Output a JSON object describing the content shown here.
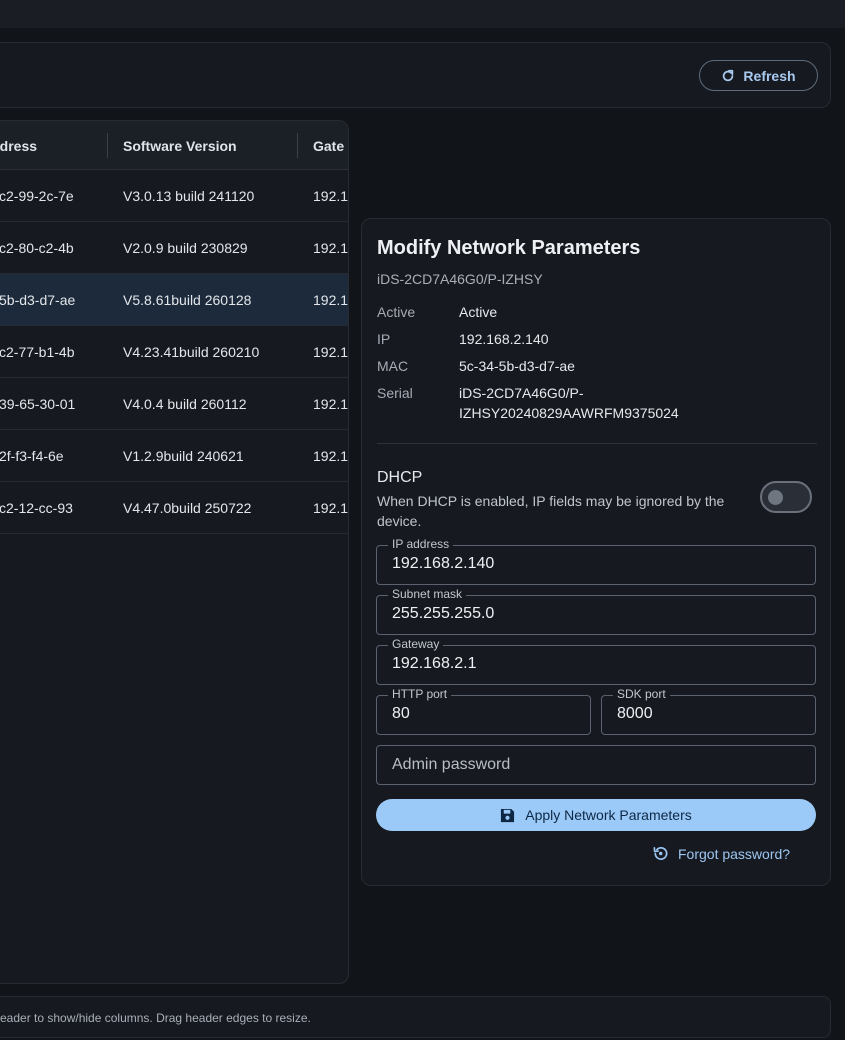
{
  "toolbar": {
    "refresh_label": "Refresh"
  },
  "table": {
    "columns": [
      "Address",
      "Software Version",
      "Gate"
    ],
    "rows": [
      {
        "address": "c2-99-2c-7e",
        "version": "V3.0.13 build 241120",
        "gateway": "192.1"
      },
      {
        "address": "c2-80-c2-4b",
        "version": "V2.0.9 build 230829",
        "gateway": "192.1"
      },
      {
        "address": "5b-d3-d7-ae",
        "version": "V5.8.61build 260128",
        "gateway": "192.1"
      },
      {
        "address": "c2-77-b1-4b",
        "version": "V4.23.41build 260210",
        "gateway": "192.1"
      },
      {
        "address": "39-65-30-01",
        "version": "V4.0.4 build 260112",
        "gateway": "192.1"
      },
      {
        "address": "2f-f3-f4-6e",
        "version": "V1.2.9build 240621",
        "gateway": "192.1"
      },
      {
        "address": "c2-12-cc-93",
        "version": "V4.47.0build 250722",
        "gateway": "192.1"
      }
    ]
  },
  "panel": {
    "title": "Modify Network Parameters",
    "subtitle": "iDS-2CD7A46G0/P-IZHSY",
    "info": {
      "active_label": "Active",
      "active_value": "Active",
      "ip_label": "IP",
      "ip_value": "192.168.2.140",
      "mac_label": "MAC",
      "mac_value": "5c-34-5b-d3-d7-ae",
      "serial_label": "Serial",
      "serial_value_line1": "iDS-2CD7A46G0/P-",
      "serial_value_line2": "IZHSY20240829AAWRFM9375024"
    },
    "dhcp": {
      "title": "DHCP",
      "description": "When DHCP is enabled, IP fields may be ignored by the device.",
      "enabled": false
    },
    "fields": {
      "ip_label": "IP address",
      "ip_value": "192.168.2.140",
      "subnet_label": "Subnet mask",
      "subnet_value": "255.255.255.0",
      "gateway_label": "Gateway",
      "gateway_value": "192.168.2.1",
      "http_label": "HTTP port",
      "http_value": "80",
      "sdk_label": "SDK port",
      "sdk_value": "8000",
      "password_placeholder": "Admin password"
    },
    "apply_label": "Apply Network Parameters",
    "forgot_label": "Forgot password?"
  },
  "footer": {
    "hint": "eader to show/hide columns. Drag header edges to resize."
  },
  "colors": {
    "accent": "#9ccaf8",
    "selected_row": "#1c2a3c",
    "background": "#111419"
  }
}
